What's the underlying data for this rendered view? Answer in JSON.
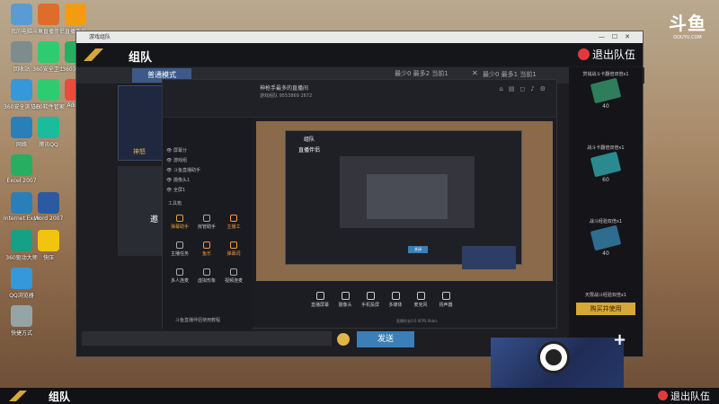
{
  "desktop_icons": [
    {
      "label": "我的电脑",
      "color": "#5b9bd5"
    },
    {
      "label": "斗鱼直播伴侣",
      "color": "#e06c2c"
    },
    {
      "label": "直播伴侣",
      "color": "#f39c12"
    },
    {
      "label": "回收站",
      "color": "#7f8c8d"
    },
    {
      "label": "360安全卫士",
      "color": "#2ecc71"
    },
    {
      "label": "360浏览器",
      "color": "#27ae60"
    },
    {
      "label": "360安全浏览器",
      "color": "#3498db"
    },
    {
      "label": "360软件管家",
      "color": "#2ecc71"
    },
    {
      "label": "Adobe",
      "color": "#e74c3c"
    },
    {
      "label": "网络",
      "color": "#2980b9"
    },
    {
      "label": "腾讯QQ",
      "color": "#1abc9c"
    },
    {
      "label": "Excel 2007",
      "color": "#27ae60"
    },
    {
      "label": "Internet Explorer",
      "color": "#2980b9"
    },
    {
      "label": "Word 2007",
      "color": "#2c5aa0"
    },
    {
      "label": "360驱动大师",
      "color": "#16a085"
    },
    {
      "label": "快压",
      "color": "#f1c40f"
    },
    {
      "label": "QQ浏览器",
      "color": "#3498db"
    },
    {
      "label": "快捷方式",
      "color": "#95a5a6"
    }
  ],
  "watermark": {
    "big": "斗鱼",
    "small": "DOUYU.COM"
  },
  "game_window": {
    "titlebar": "游戏组队",
    "title": "组队",
    "exit_label": "退出队伍",
    "mode_tab": "普通模式",
    "min_count": "最少0 最多2 当前1",
    "max_count": "最少0 最多1 当前1",
    "left_card_tag": "神怒",
    "left_card2_text": "邀"
  },
  "shop": {
    "items": [
      {
        "name": "赏钱战斗卡翻倍双倍x1",
        "price": "40",
        "color": "#2e7d5b"
      },
      {
        "name": "战斗卡翻倍双倍x1",
        "price": "60",
        "color": "#2a8a8f"
      },
      {
        "name": "战斗经验双倍x1",
        "price": "40",
        "color": "#2e6d8f"
      }
    ],
    "footer": "天限战斗经验双倍x1",
    "buy_label": "购买并使用"
  },
  "chat": {
    "send_label": "发送"
  },
  "stream_app": {
    "tabs": [
      "我的场景",
      "双击",
      "可修改",
      "场景1",
      "+"
    ],
    "room_title": "神枪手最多的直播间",
    "stats": "游戏组队  9553869  2672",
    "list": [
      "屏幕分",
      "游戏组",
      "斗鱼直播助手",
      "摄像头1",
      "全屏1"
    ],
    "tools_title": "工具箱",
    "tools": [
      {
        "label": "弹幕助手",
        "orange": true
      },
      {
        "label": "房管助手",
        "orange": false
      },
      {
        "label": "主播工",
        "orange": true
      },
      {
        "label": "主播任务",
        "orange": false
      },
      {
        "label": "鱼乐",
        "orange": true
      },
      {
        "label": "弹幕词",
        "orange": true
      },
      {
        "label": "多人连麦",
        "orange": false
      },
      {
        "label": "虚拟形象",
        "orange": false
      },
      {
        "label": "视频连麦",
        "orange": false
      }
    ],
    "preview": {
      "title": "组队",
      "logo": "直播伴侣",
      "btn": "关闭"
    },
    "buttons": [
      "直播屏幕",
      "摄像头",
      "手机投屏",
      "多媒体",
      "麦克风",
      "扬声器"
    ],
    "footer": "斗鱼直播伴侣使用教程",
    "status": "直播时长0:0  0FPS  0kb/s"
  },
  "bottom_bar": {
    "title": "组队",
    "exit_label": "退出队伍"
  }
}
